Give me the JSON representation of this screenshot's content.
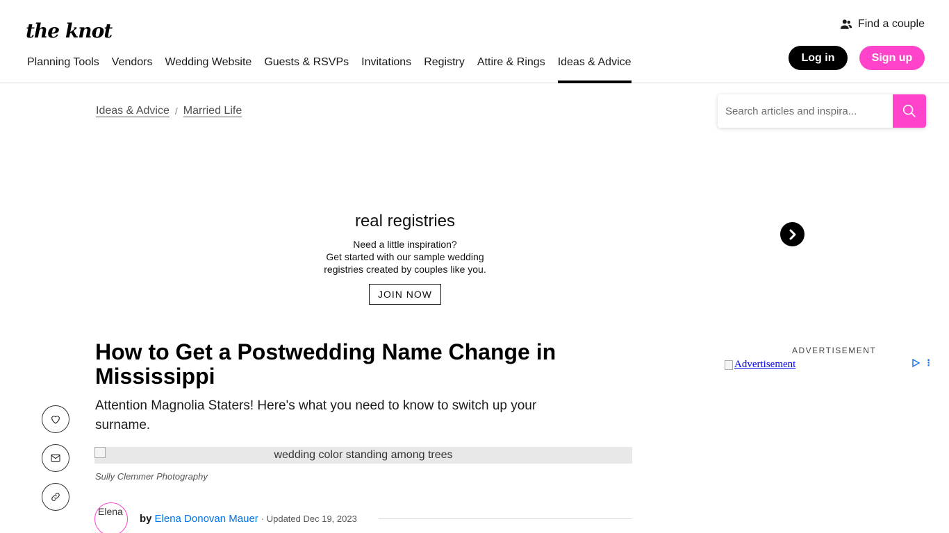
{
  "header": {
    "logo": "the knot",
    "find_couple": "Find a couple",
    "nav": [
      {
        "label": "Planning Tools"
      },
      {
        "label": "Vendors"
      },
      {
        "label": "Wedding Website"
      },
      {
        "label": "Guests & RSVPs"
      },
      {
        "label": "Invitations"
      },
      {
        "label": "Registry"
      },
      {
        "label": "Attire & Rings"
      },
      {
        "label": "Ideas & Advice",
        "active": true
      }
    ],
    "login": "Log in",
    "signup": "Sign up"
  },
  "breadcrumb": {
    "items": [
      "Ideas & Advice",
      "Married Life"
    ],
    "separator": "/"
  },
  "search": {
    "placeholder": "Search articles and inspira..."
  },
  "ad_banner": {
    "title": "real registries",
    "line1": "Need a little inspiration?",
    "line2": "Get started with our sample wedding",
    "line3": "registries created by couples like you.",
    "cta": "JOIN NOW"
  },
  "article": {
    "title": "How to Get a Postwedding Name Change in Mississippi",
    "subtitle": "Attention Magnolia Staters! Here's what you need to know to switch up your surname.",
    "hero_alt": "wedding color standing among trees",
    "photo_credit": "Sully Clemmer Photography",
    "author_avatar_alt": "Elena",
    "byline_prefix": "by",
    "author": "Elena Donovan Mauer",
    "updated": "· Updated Dec 19, 2023"
  },
  "sidebar": {
    "ad_label": "ADVERTISEMENT",
    "ad_alt": "Advertisement",
    "ad_menu": "⋮"
  },
  "colors": {
    "brand_pink": "#ff44cb",
    "link_blue": "#0073e6",
    "black": "#000000"
  }
}
